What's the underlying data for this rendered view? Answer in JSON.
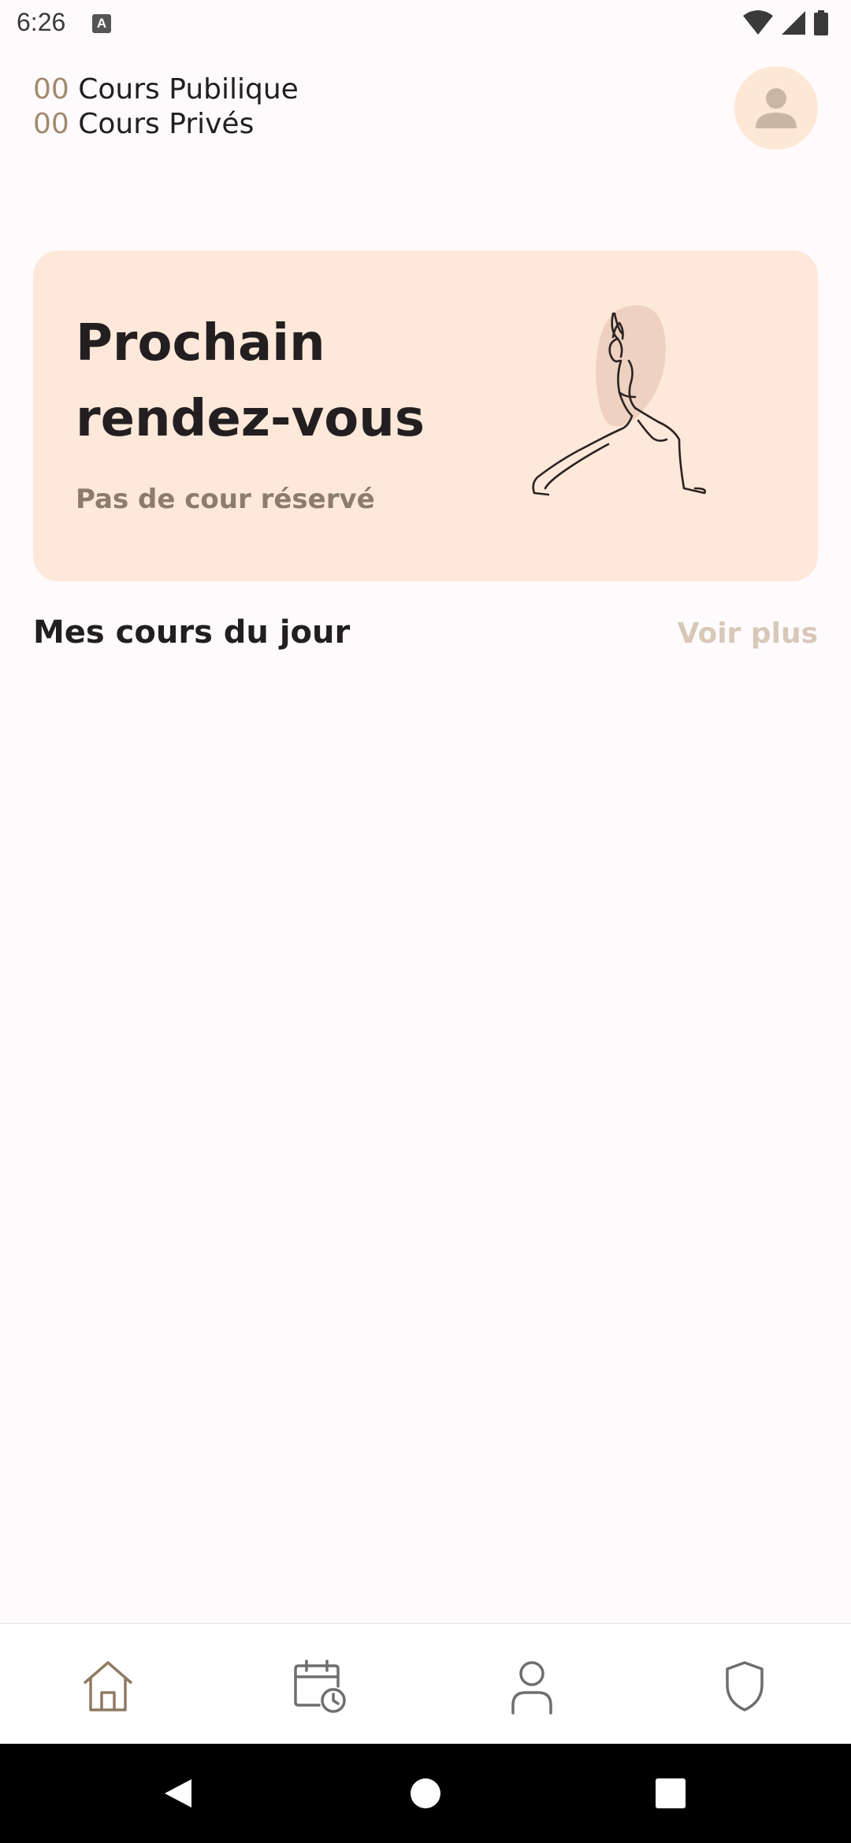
{
  "status_bar": {
    "time": "6:26",
    "notification_icon_letter": "A"
  },
  "counts": {
    "public_count": "00",
    "public_label": "Cours Pubilique",
    "private_count": "00",
    "private_label": "Cours Privés"
  },
  "banner": {
    "title": "Prochain rendez-vous",
    "subtitle": "Pas de cour réservé",
    "illustration": "yoga-pose-line-art",
    "background_color": "#fde8d9"
  },
  "section": {
    "title": "Mes cours du jour",
    "see_more_label": "Voir plus"
  },
  "bottom_nav": {
    "items": [
      {
        "icon": "home-icon",
        "active": true
      },
      {
        "icon": "calendar-clock-icon",
        "active": false
      },
      {
        "icon": "user-icon",
        "active": false
      },
      {
        "icon": "shield-icon",
        "active": false
      }
    ]
  },
  "colors": {
    "accent": "#a28a6f",
    "text": "#231f20",
    "muted": "#d8c8b8"
  }
}
